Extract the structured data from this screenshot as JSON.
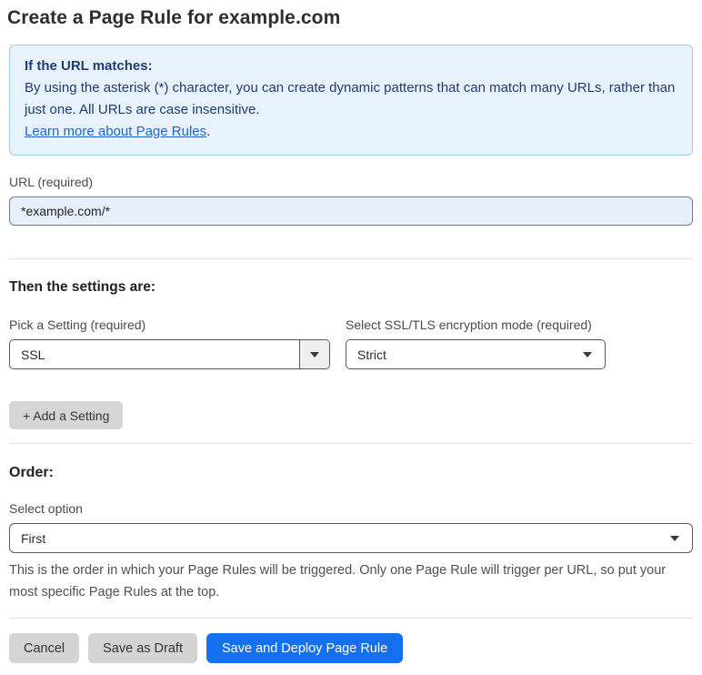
{
  "page": {
    "title": "Create a Page Rule for example.com"
  },
  "info_box": {
    "heading": "If the URL matches:",
    "body": "By using the asterisk (*) character, you can create dynamic patterns that can match many URLs, rather than just one. All URLs are case insensitive.",
    "link_label": "Learn more about Page Rules",
    "link_suffix": "."
  },
  "url_field": {
    "label": "URL (required)",
    "value": "*example.com/*"
  },
  "settings": {
    "heading": "Then the settings are:",
    "setting_select": {
      "label": "Pick a Setting (required)",
      "value": "SSL"
    },
    "mode_select": {
      "label": "Select SSL/TLS encryption mode (required)",
      "value": "Strict"
    },
    "add_button_label": "+ Add a Setting"
  },
  "order": {
    "heading": "Order:",
    "select_label": "Select option",
    "value": "First",
    "help_text": "This is the order in which your Page Rules will be triggered. Only one Page Rule will trigger per URL, so put your most specific Page Rules at the top."
  },
  "footer": {
    "cancel_label": "Cancel",
    "save_draft_label": "Save as Draft",
    "save_deploy_label": "Save and Deploy Page Rule"
  },
  "colors": {
    "primary_button": "#1570ef",
    "info_box_background": "#e8f2fc",
    "info_box_border": "#a6cbee",
    "info_text": "#1e3c6e",
    "link": "#2363cf",
    "url_input_background": "#e8f0fd",
    "gray_button": "#d4d4d4"
  }
}
